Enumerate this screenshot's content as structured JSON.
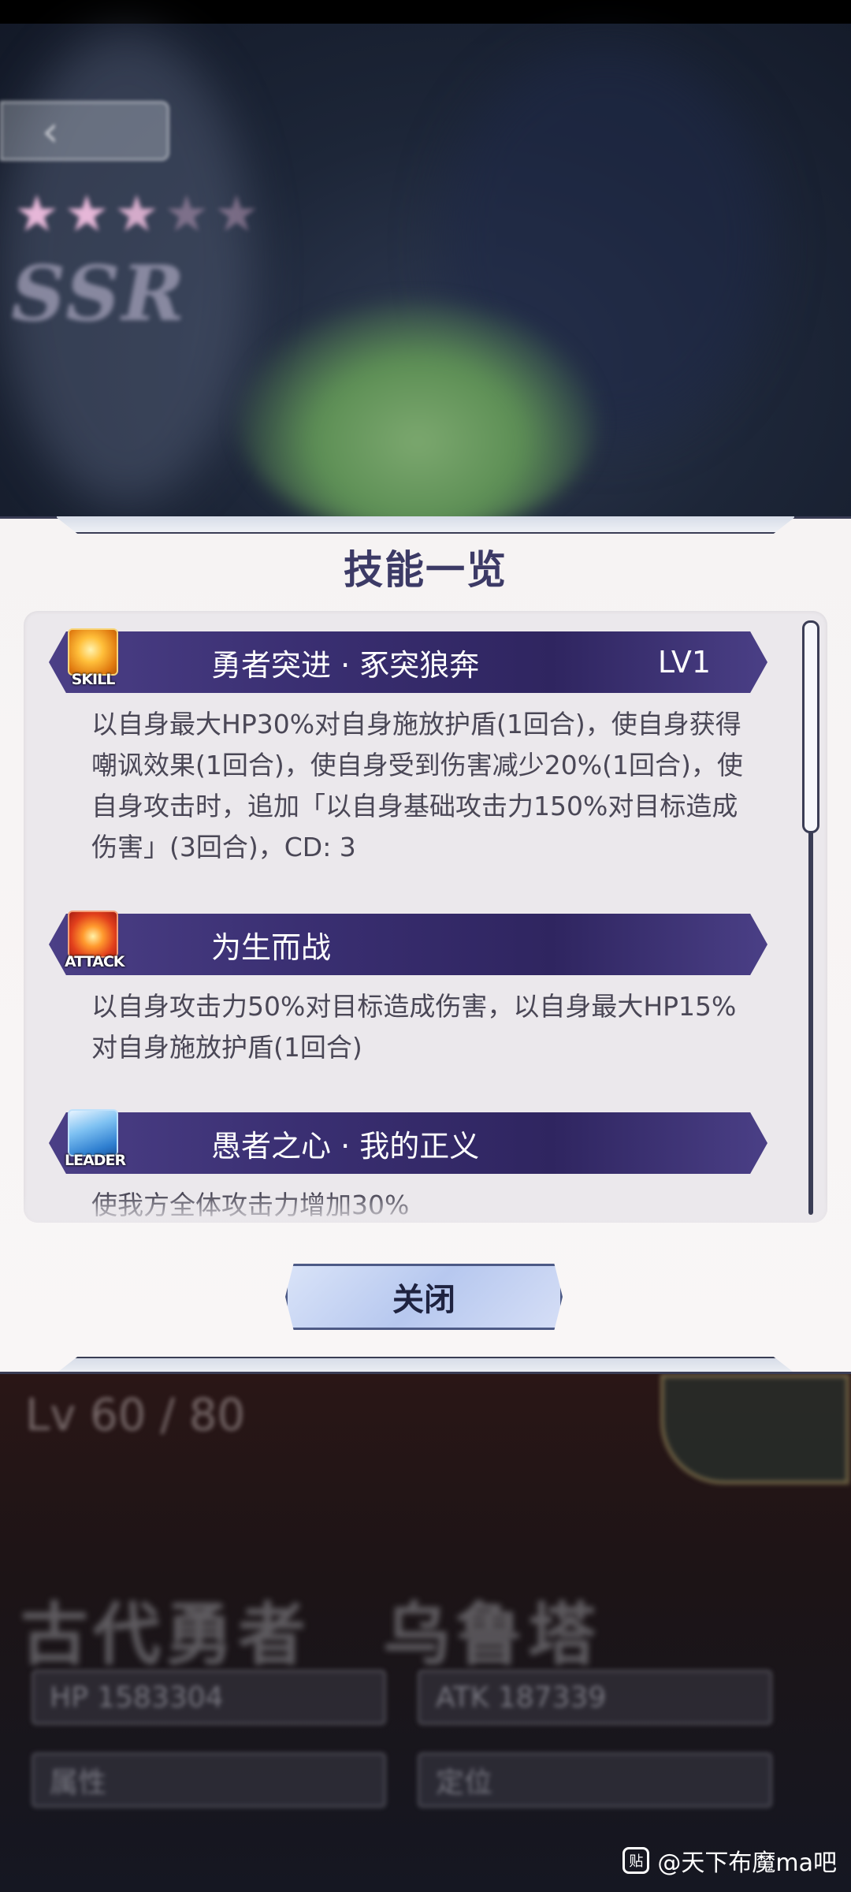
{
  "background": {
    "back_glyph": "‹",
    "stars": [
      "★",
      "★",
      "★",
      "★",
      "★"
    ],
    "rarity": "SSR"
  },
  "dialog": {
    "title": "技能一览",
    "close_label": "关闭",
    "skills": [
      {
        "icon_tag": "SKILL",
        "icon_name": "skill-swirl-icon",
        "name": "勇者突进 · 豖突狼奔",
        "level": "LV1",
        "description": "以自身最大HP30%对自身施放护盾(1回合)，使自身获得\n嘲讽效果(1回合)，使自身受到伤害减少20%(1回合)，使\n自身攻击时，追加「以自身基础攻击力150%对目标造成\n伤害」(3回合)，CD: 3"
      },
      {
        "icon_tag": "ATTACK",
        "icon_name": "attack-fire-icon",
        "name": "为生而战",
        "level": "",
        "description": "以自身攻击力50%对目标造成伤害，以自身最大HP15%\n对自身施放护盾(1回合)"
      },
      {
        "icon_tag": "LEADER",
        "icon_name": "leader-wing-icon",
        "name": "愚者之心 · 我的正义",
        "level": "",
        "description": "使我方全体攻击力增加30%"
      }
    ]
  },
  "character": {
    "level_text": "Lv 60 / 80",
    "name": "古代勇者　乌鲁塔",
    "hp_text": "HP   1583304",
    "atk_text": "ATK   187339",
    "attr_label": "属性",
    "pos_label": "定位"
  },
  "watermark": {
    "icon_glyph": "贴",
    "text": "@天下布魔ma吧"
  },
  "colors": {
    "header_purple": "#3a2f72",
    "title_color": "#3c3a66",
    "desc_color": "#4a4756"
  }
}
